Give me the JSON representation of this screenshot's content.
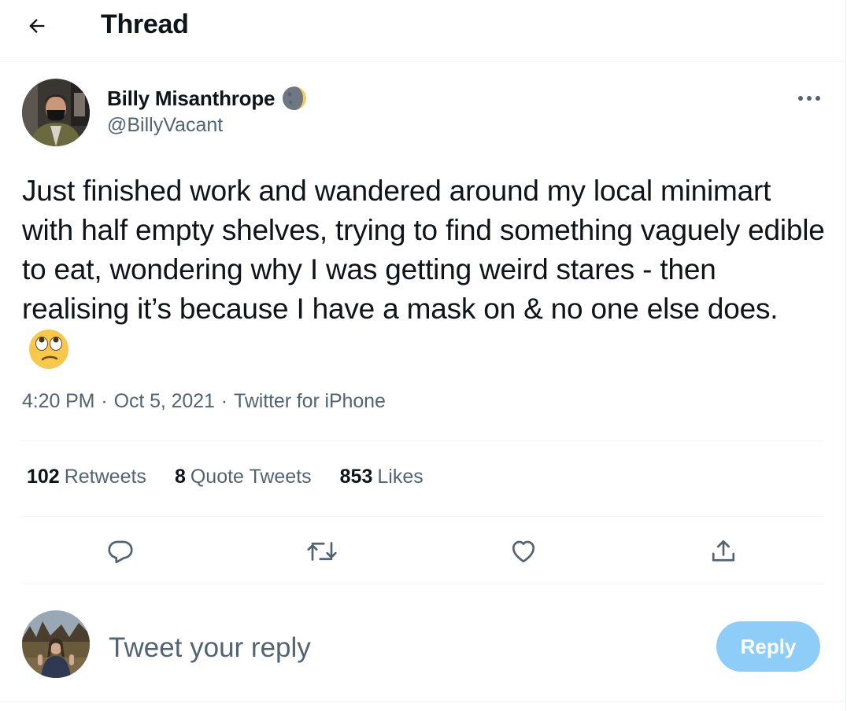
{
  "header": {
    "back_icon": "arrow-left-icon",
    "title": "Thread"
  },
  "tweet": {
    "author": {
      "name": "Billy Misanthrope",
      "name_icon": "moon-phase-icon",
      "handle": "@BillyVacant"
    },
    "more_icon": "more-horizontal-icon",
    "text": "Just finished work and wandered around my local minimart with half empty shelves, trying to find something vaguely edible to eat, wondering why I was getting weird stares - then realising it’s because I have a mask on & no one else does.",
    "text_emoji": "face-with-rolling-eyes-icon",
    "time": "4:20 PM",
    "date": "Oct 5, 2021",
    "source": "Twitter for iPhone",
    "separator": "·"
  },
  "stats": {
    "retweets": {
      "count": "102",
      "label": "Retweets"
    },
    "quotes": {
      "count": "8",
      "label": "Quote Tweets"
    },
    "likes": {
      "count": "853",
      "label": "Likes"
    }
  },
  "actions": [
    "reply-icon",
    "retweet-icon",
    "like-icon",
    "share-icon"
  ],
  "composer": {
    "placeholder": "Tweet your reply",
    "button_label": "Reply"
  },
  "colors": {
    "text": "#0f1419",
    "secondary": "#536471",
    "border": "#eff3f4",
    "reply_button": "#8ecdf7"
  }
}
